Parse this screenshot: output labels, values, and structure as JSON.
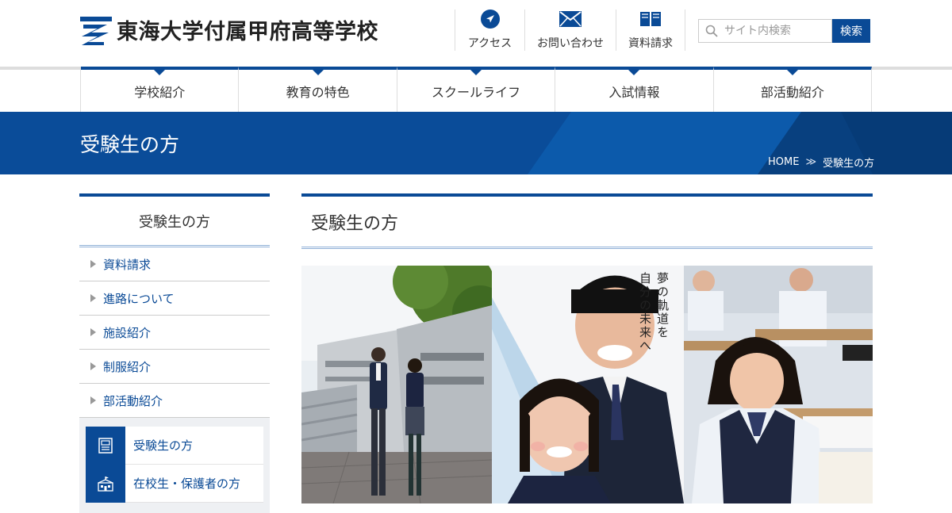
{
  "header": {
    "logo_text": "東海大学付属甲府高等学校",
    "utilities": [
      {
        "label": "アクセス",
        "icon": "location-arrow-icon"
      },
      {
        "label": "お問い合わせ",
        "icon": "envelope-icon"
      },
      {
        "label": "資料請求",
        "icon": "book-icon"
      }
    ],
    "search": {
      "placeholder": "サイト内検索",
      "button_label": "検索"
    }
  },
  "gnav": {
    "items": [
      "学校紹介",
      "教育の特色",
      "スクールライフ",
      "入試情報",
      "部活動紹介"
    ]
  },
  "banner": {
    "title": "受験生の方",
    "breadcrumb": {
      "home": "HOME",
      "current": "受験生の方"
    }
  },
  "sidebar": {
    "heading": "受験生の方",
    "items": [
      "資料請求",
      "進路について",
      "施設紹介",
      "制服紹介",
      "部活動紹介"
    ],
    "features": [
      {
        "label": "受験生の方",
        "icon": "document-icon"
      },
      {
        "label": "在校生・保護者の方",
        "icon": "school-building-icon"
      }
    ]
  },
  "main": {
    "heading": "受験生の方",
    "photo2_caption_line1": "夢の軌道を",
    "photo2_caption_line2": "自分の未来へ"
  },
  "colors": {
    "brand": "#0a4a96",
    "banner": "#0a4c99",
    "rule": "#dddddd"
  }
}
